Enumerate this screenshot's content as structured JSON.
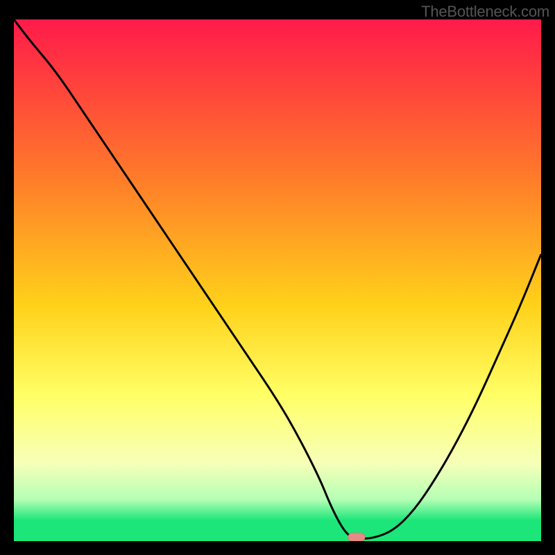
{
  "watermark": "TheBottleneck.com",
  "colors": {
    "page_bg": "#000000",
    "gradient_top": "#ff1a4a",
    "gradient_mid_upper": "#ff7a2a",
    "gradient_mid": "#ffd21a",
    "gradient_lower": "#ffff66",
    "gradient_pale": "#f7ffb8",
    "gradient_light_green": "#b5ffb5",
    "gradient_green": "#1ce67a",
    "curve_stroke": "#000000",
    "marker_fill": "#e78b87",
    "marker_stroke": "#d77470"
  },
  "chart_data": {
    "type": "line",
    "title": "",
    "xlabel": "",
    "ylabel": "",
    "xlim": [
      0,
      100
    ],
    "ylim": [
      0,
      100
    ],
    "series": [
      {
        "name": "bottleneck-curve",
        "x": [
          0,
          3,
          8,
          14,
          20,
          26,
          32,
          38,
          44,
          50,
          54,
          58,
          60,
          62,
          63.5,
          65,
          68,
          72,
          76,
          80,
          84,
          88,
          92,
          96,
          100
        ],
        "y": [
          100,
          96,
          90,
          81,
          72,
          63,
          54,
          45,
          36,
          27,
          20,
          12,
          7,
          3,
          1,
          0.5,
          0.5,
          2,
          6,
          12,
          19,
          27,
          36,
          45,
          55
        ]
      }
    ],
    "marker": {
      "x": 65,
      "y": 0.5
    },
    "gradient_stops_pct": [
      0,
      30,
      55,
      72,
      85,
      92,
      96,
      100
    ]
  }
}
